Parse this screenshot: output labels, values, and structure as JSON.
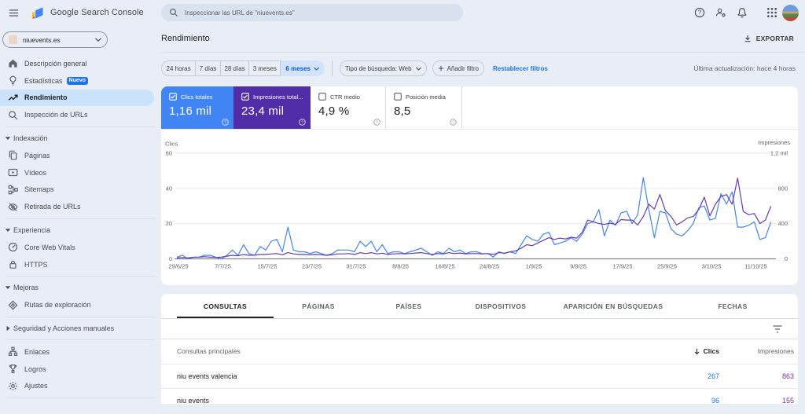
{
  "topbar": {
    "app_title": "Google Search Console",
    "search_placeholder": "Inspeccionar las URL de \"niuevents.es\""
  },
  "sidebar": {
    "property": "niuevents.es",
    "sections": [
      {
        "items": [
          {
            "icon": "home-icon",
            "label": "Descripción general"
          },
          {
            "icon": "bulb-icon",
            "label": "Estadísticas",
            "badge": "Nuevo"
          },
          {
            "icon": "trend-icon",
            "label": "Rendimiento",
            "active": true
          },
          {
            "icon": "search-icon",
            "label": "Inspección de URLs"
          }
        ]
      },
      {
        "header": "Indexación",
        "items": [
          {
            "icon": "pages-icon",
            "label": "Páginas"
          },
          {
            "icon": "video-icon",
            "label": "Vídeos"
          },
          {
            "icon": "sitemap-icon",
            "label": "Sitemaps"
          },
          {
            "icon": "eye-off-icon",
            "label": "Retirada de URLs"
          }
        ]
      },
      {
        "header": "Experiencia",
        "items": [
          {
            "icon": "gauge-icon",
            "label": "Core Web Vitals"
          },
          {
            "icon": "lock-icon",
            "label": "HTTPS"
          }
        ]
      },
      {
        "header": "Mejoras",
        "items": [
          {
            "icon": "route-icon",
            "label": "Rutas de exploración"
          }
        ]
      },
      {
        "header": "Seguridad y Acciones manuales",
        "collapsed": true,
        "items": []
      },
      {
        "items": [
          {
            "icon": "links-icon",
            "label": "Enlaces"
          },
          {
            "icon": "trophy-icon",
            "label": "Logros"
          },
          {
            "icon": "gear-icon",
            "label": "Ajustes"
          }
        ]
      }
    ]
  },
  "header": {
    "page_title": "Rendimiento",
    "export_label": "EXPORTAR",
    "last_update": "Última actualización: hace 4 horas"
  },
  "filters": {
    "date_ranges": [
      "24 horas",
      "7 días",
      "28 días",
      "3 meses",
      "6 meses"
    ],
    "selected_range": "6 meses",
    "search_type": "Tipo de búsqueda: Web",
    "add_filter": "Añadir filtro",
    "reset": "Restablecer filtros"
  },
  "tiles": [
    {
      "label": "Clics totales",
      "value": "1,16 mil",
      "checked": true,
      "color": "#4184f3"
    },
    {
      "label": "Impresiones total...",
      "value": "23,4 mil",
      "checked": true,
      "color": "#512da8"
    },
    {
      "label": "CTR medio",
      "value": "4,9 %",
      "checked": false
    },
    {
      "label": "Posición media",
      "value": "8,5",
      "checked": false
    }
  ],
  "chart_data": {
    "type": "line",
    "left_axis": {
      "title": "Clics",
      "ticks": [
        "0",
        "20",
        "40",
        "60"
      ],
      "max": 60
    },
    "right_axis": {
      "title": "Impresiones",
      "ticks": [
        "0",
        "400",
        "800",
        "1,2 mil"
      ],
      "max": 1200
    },
    "x_tick_labels": [
      "29/6/25",
      "7/7/25",
      "15/7/25",
      "23/7/25",
      "31/7/25",
      "8/8/25",
      "16/8/25",
      "24/8/25",
      "1/9/25",
      "9/9/25",
      "17/9/25",
      "25/9/25",
      "3/10/25",
      "11/10/25"
    ],
    "x_ticks_every": 8,
    "series": [
      {
        "name": "Clics",
        "color": "#4285f4",
        "axis": "left",
        "values": [
          1,
          2,
          0,
          1,
          1,
          2,
          2,
          1,
          0,
          2,
          5,
          2,
          8,
          3,
          2,
          7,
          5,
          10,
          11,
          4,
          18,
          5,
          4,
          4,
          3,
          4,
          3,
          2,
          3,
          5,
          5,
          5,
          4,
          10,
          7,
          10,
          4,
          8,
          3,
          4,
          4,
          3,
          4,
          5,
          6,
          4,
          2,
          4,
          3,
          6,
          4,
          5,
          3,
          4,
          4,
          3,
          3,
          1,
          4,
          3,
          4,
          3,
          8,
          13,
          11,
          10,
          14,
          15,
          8,
          9,
          10,
          12,
          10,
          14,
          20,
          21,
          28,
          13,
          22,
          19,
          26,
          27,
          20,
          25,
          46,
          28,
          12,
          27,
          26,
          17,
          14,
          13,
          16,
          20,
          29,
          30,
          22,
          23,
          37,
          31,
          38,
          18,
          18,
          19,
          21,
          11,
          12,
          21
        ]
      },
      {
        "name": "Impresiones",
        "color": "#673ab7",
        "axis": "right",
        "values": [
          10,
          15,
          12,
          18,
          20,
          24,
          20,
          16,
          20,
          30,
          40,
          36,
          50,
          40,
          42,
          50,
          50,
          56,
          60,
          46,
          70,
          56,
          50,
          50,
          46,
          50,
          46,
          40,
          46,
          56,
          56,
          60,
          50,
          70,
          60,
          70,
          56,
          64,
          50,
          56,
          60,
          56,
          60,
          66,
          70,
          60,
          50,
          60,
          56,
          70,
          60,
          66,
          56,
          60,
          60,
          56,
          60,
          50,
          70,
          64,
          80,
          90,
          120,
          160,
          150,
          180,
          210,
          240,
          220,
          235,
          225,
          245,
          235,
          300,
          440,
          420,
          400,
          390,
          405,
          390,
          445,
          440,
          440,
          385,
          480,
          620,
          565,
          730,
          545,
          480,
          385,
          420,
          465,
          480,
          560,
          700,
          486,
          620,
          708,
          729,
          619,
          916,
          539,
          500,
          515,
          400,
          440,
          598
        ]
      }
    ]
  },
  "table": {
    "tabs": [
      "CONSULTAS",
      "PÁGINAS",
      "PAÍSES",
      "DISPOSITIVOS",
      "APARICIÓN EN BÚSQUEDAS",
      "FECHAS"
    ],
    "active_tab": "CONSULTAS",
    "col_main": "Consultas principales",
    "col_clics": "Clics",
    "col_impressions": "Impresiones",
    "rows": [
      {
        "query": "niu events valencia",
        "clics": "267",
        "impressions": "863"
      },
      {
        "query": "niu events",
        "clics": "96",
        "impressions": "155"
      }
    ]
  }
}
